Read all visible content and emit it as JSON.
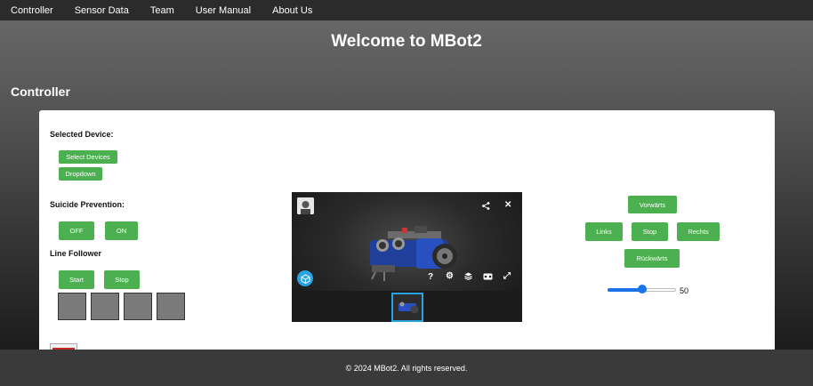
{
  "nav": {
    "items": [
      {
        "label": "Controller"
      },
      {
        "label": "Sensor Data"
      },
      {
        "label": "Team"
      },
      {
        "label": "User Manual"
      },
      {
        "label": "About Us"
      }
    ]
  },
  "hero": {
    "title": "Welcome to MBot2"
  },
  "section": {
    "title": "Controller"
  },
  "device": {
    "label": "Selected Device:",
    "select_button": "Select Devices",
    "dropdown_button": "Dropdown"
  },
  "suicide": {
    "label": "Suicide Prevention:",
    "off_button": "OFF",
    "on_button": "ON"
  },
  "line_follower": {
    "label": "Line Follower",
    "start_button": "Start",
    "stop_button": "Stop"
  },
  "drive": {
    "forward": "Vorwärts",
    "left": "Links",
    "stop": "Stop",
    "right": "Rechts",
    "backward": "Rückwärts"
  },
  "speed": {
    "value": 50,
    "min": 0,
    "max": 100,
    "label": "50"
  },
  "viewer": {
    "icons": [
      "share-icon",
      "close-icon",
      "help-icon",
      "settings-icon",
      "layers-icon",
      "vr-icon",
      "fullscreen-icon",
      "cube-icon"
    ]
  },
  "colors": {
    "accent": "#4caf50",
    "viewer_accent": "#29a3e0",
    "slider": "#1a73e8"
  },
  "footer": {
    "text": "© 2024 MBot2. All rights reserved."
  }
}
